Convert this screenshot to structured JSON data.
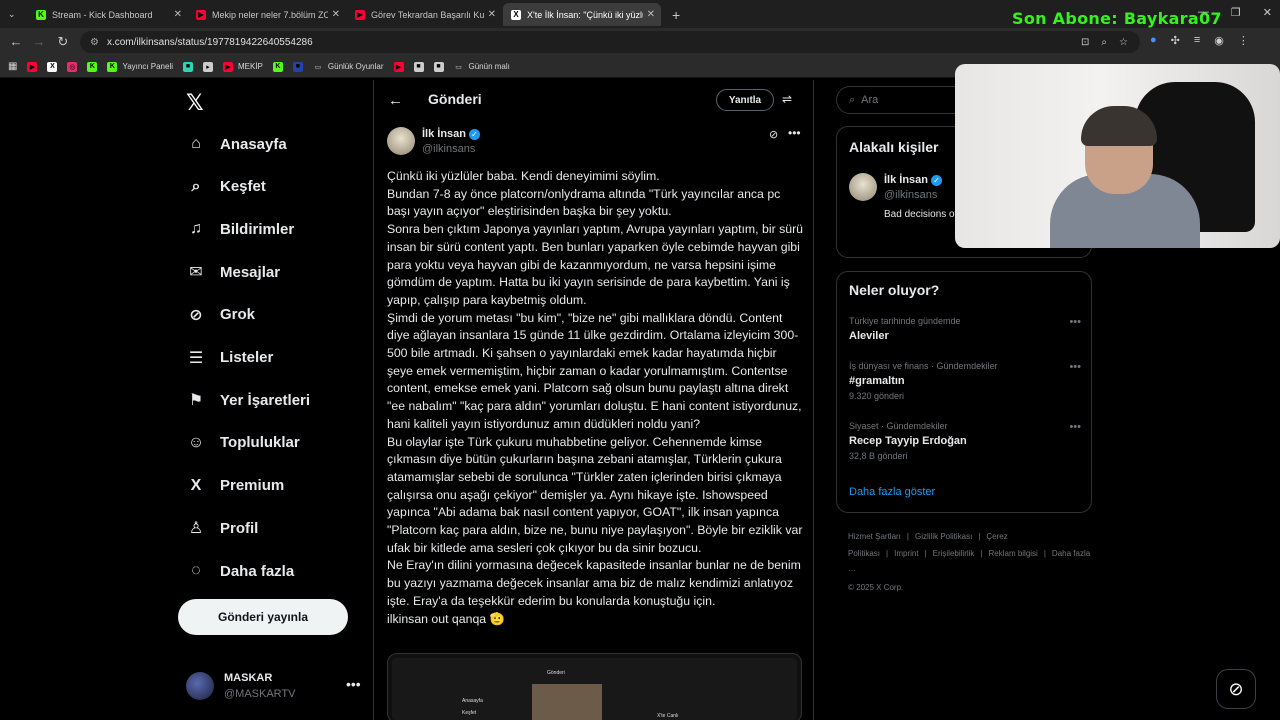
{
  "browser": {
    "tabs": [
      {
        "title": "Stream - Kick Dashboard",
        "icon": "kick-icon",
        "color": "#53fc18"
      },
      {
        "title": "Mekip neler neler 7.bölüm ZOR",
        "icon": "youtube-icon",
        "color": "#ff0033"
      },
      {
        "title": "Görev Tekrardan Başarılı Kumta",
        "icon": "youtube-icon",
        "color": "#ff0033"
      },
      {
        "title": "X'te İlk İnsan: \"Çünkü iki yüzlül",
        "icon": "x-icon",
        "color": "#ffffff",
        "active": true
      }
    ],
    "url": "x.com/ilkinsans/status/1977819422640554286",
    "bookmarks": [
      {
        "label": "",
        "icon": "youtube-icon",
        "color": "#ff0033"
      },
      {
        "label": "",
        "icon": "x-icon",
        "color": "#ffffff"
      },
      {
        "label": "",
        "icon": "instagram-icon",
        "color": "#e1306c"
      },
      {
        "label": "",
        "icon": "kick-icon",
        "color": "#53fc18"
      },
      {
        "label": "Yayıncı Paneli",
        "icon": "kick-icon",
        "color": "#53fc18"
      },
      {
        "label": "",
        "icon": "app-icon",
        "color": "#2bd6b4"
      },
      {
        "label": "",
        "icon": "play-icon",
        "color": "#cccccc"
      },
      {
        "label": "MEKİP",
        "icon": "youtube-icon",
        "color": "#ff0033"
      },
      {
        "label": "",
        "icon": "kick-icon",
        "color": "#53fc18"
      },
      {
        "label": "",
        "icon": "app-icon",
        "color": "#2244aa"
      },
      {
        "label": "Günlük Oyunlar",
        "icon": "folder-icon",
        "color": "#cccccc"
      },
      {
        "label": "",
        "icon": "youtube-icon",
        "color": "#ff0033"
      },
      {
        "label": "",
        "icon": "app-icon",
        "color": "#cccccc"
      },
      {
        "label": "",
        "icon": "app-icon",
        "color": "#cccccc"
      },
      {
        "label": "Günün malı",
        "icon": "folder-icon",
        "color": "#cccccc"
      }
    ]
  },
  "stream_overlay": "Son Abone: Baykara07",
  "nav": {
    "items": [
      {
        "label": "Anasayfa",
        "icon": "home-icon"
      },
      {
        "label": "Keşfet",
        "icon": "search-icon"
      },
      {
        "label": "Bildirimler",
        "icon": "bell-icon"
      },
      {
        "label": "Mesajlar",
        "icon": "mail-icon"
      },
      {
        "label": "Grok",
        "icon": "grok-icon"
      },
      {
        "label": "Listeler",
        "icon": "list-icon"
      },
      {
        "label": "Yer İşaretleri",
        "icon": "bookmark-icon"
      },
      {
        "label": "Topluluklar",
        "icon": "people-icon"
      },
      {
        "label": "Premium",
        "icon": "x-icon"
      },
      {
        "label": "Profil",
        "icon": "profile-icon"
      },
      {
        "label": "Daha fazla",
        "icon": "more-icon"
      }
    ],
    "post_button": "Gönderi yayınla",
    "account": {
      "name": "MASKAR",
      "handle": "@MASKARTV"
    }
  },
  "post": {
    "header_title": "Gönderi",
    "reply_button": "Yanıtla",
    "author": {
      "name": "İlk İnsan",
      "handle": "@ilkinsans"
    },
    "paragraphs": [
      "Çünkü iki yüzlüler baba. Kendi deneyimimi söylim.",
      "Bundan 7-8 ay önce platcorn/onlydrama altında \"Türk yayıncılar anca pc başı yayın açıyor\" eleştirisinden başka bir şey yoktu.",
      "Sonra ben çıktım Japonya yayınları yaptım, Avrupa yayınları yaptım, bir sürü insan bir sürü content yaptı. Ben bunları yaparken öyle cebimde hayvan gibi para yoktu veya hayvan gibi de kazanmıyordum, ne varsa hepsini işime gömdüm de yaptım. Hatta bu iki yayın serisinde de para kaybettim. Yani iş yapıp, çalışıp para kaybetmiş oldum.",
      "Şimdi de yorum metası \"bu kim\", \"bize ne\" gibi mallıklara döndü. Content diye ağlayan insanlara 15 günde 11 ülke gezdirdim. Ortalama izleyicim 300-500 bile artmadı. Ki şahsen o yayınlardaki emek kadar hayatımda hiçbir şeye emek vermemiştim, hiçbir zaman o kadar yorulmamıştım. Contentse content, emekse emek yani. Platcorn sağ olsun bunu paylaştı altına direkt \"ee nabalım\" \"kaç para aldın\" yorumları doluştu. E hani content istiyordunuz, hani kaliteli yayın istiyordunuz amın düdükleri noldu yani?",
      "Bu olaylar işte Türk çukuru muhabbetine geliyor. Cehennemde kimse çıkmasın diye bütün çukurların başına zebani atamışlar, Türklerin çukura atamamışlar sebebi de sorulunca \"Türkler zaten içlerinden birisi çıkmaya çalışırsa onu aşağı çekiyor\" demişler ya. Aynı hikaye işte. Ishowspeed yapınca \"Abi adama bak nasıl content yapıyor, GOAT\", ilk insan yapınca \"Platcorn kaç para aldın, bize ne, bunu niye paylaşıyon\". Böyle bir ezik­lik var ufak bir kitlede ama sesleri çok çıkıyor bu da sinir bozucu.",
      "Ne Eray'ın dilini yormasına değecek kapasitede insanlar bunlar ne de benim bu yazıyı yazmama değecek insanlar ama biz de malız kendimizi anlatıyoz işte. Eray'a da teşekkür ederim bu konularda konuştuğu için.",
      "ilkinsan out qanqa 🫡"
    ],
    "media_labels": {
      "home": "Anasayfa",
      "explore": "Keşfet",
      "tab": "Gönderi",
      "side": "X'te Canlı"
    }
  },
  "sidebar": {
    "search_placeholder": "Ara",
    "related": {
      "title": "Alakalı kişiler",
      "name": "İlk İnsan",
      "handle": "@ilkinsans",
      "bio": "Bad decisions of guy Founde ilkinsan@gma"
    },
    "trends_title": "Neler oluyor?",
    "trends": [
      {
        "category": "Türkiye tarihinde gündemde",
        "topic": "Aleviler",
        "count": ""
      },
      {
        "category": "İş dünyası ve finans · Gündemdekiler",
        "topic": "#gramaltın",
        "count": "9.320 gönderi"
      },
      {
        "category": "Siyaset · Gündemdekiler",
        "topic": "Recep Tayyip Erdoğan",
        "count": "32,8 B gönderi"
      }
    ],
    "show_more": "Daha fazla göster",
    "footer_links": [
      "Hizmet Şartları",
      "|",
      "Gizlilik Politikası",
      "|",
      "Çerez Politikası",
      "|",
      "Imprint",
      "|",
      "Erişilebilirlik",
      "|",
      "Reklam bilgisi",
      "|",
      "Daha fazla ···"
    ],
    "copyright": "© 2025 X Corp."
  },
  "colors": {
    "accent": "#1d9bf0",
    "overlay": "#35f21f"
  }
}
